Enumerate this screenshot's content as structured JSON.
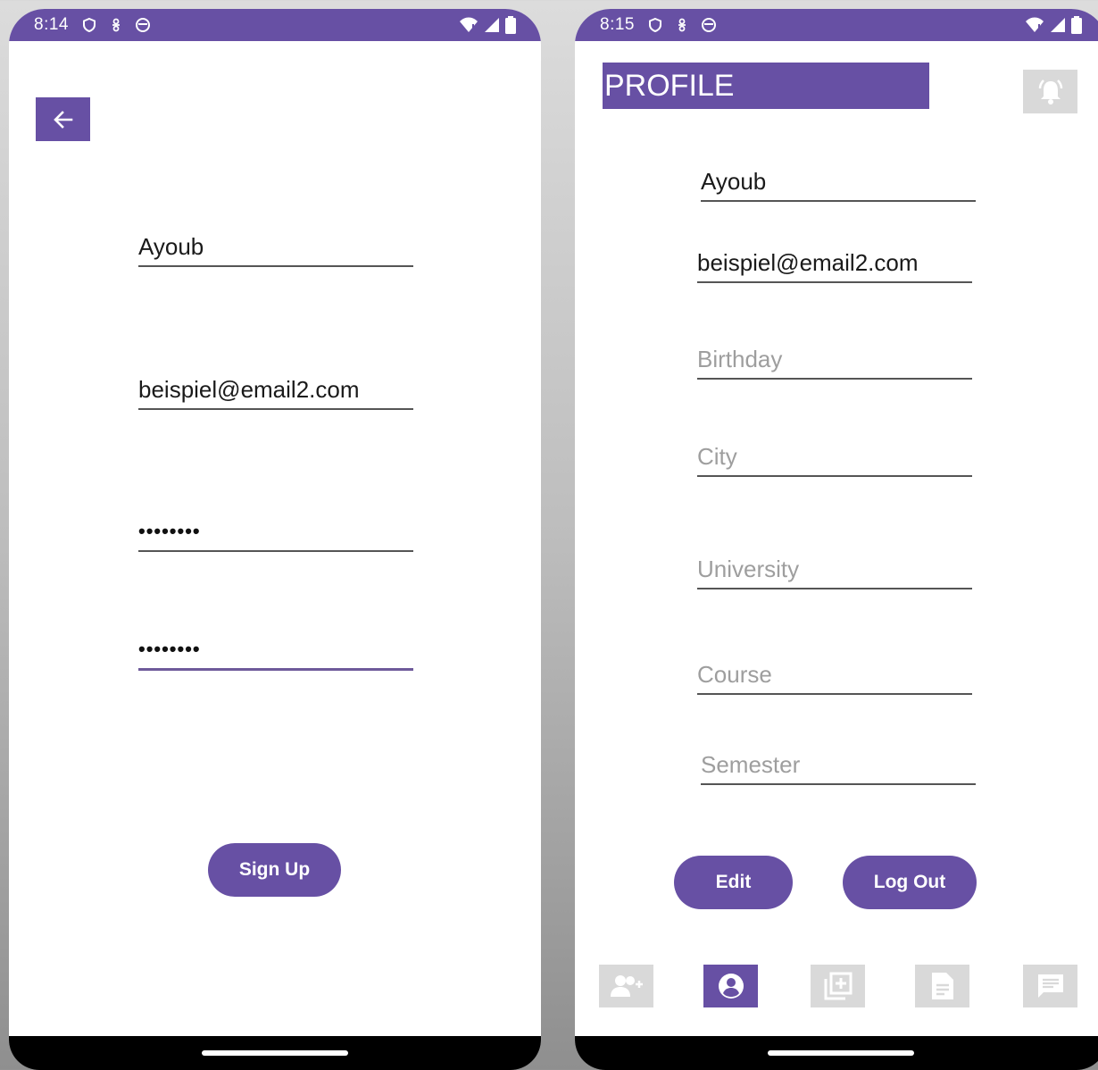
{
  "left_screen": {
    "status": {
      "time": "8:14"
    },
    "form": {
      "name": "Ayoub",
      "email": "beispiel@email2.com",
      "password": "••••••••",
      "confirm_password": "••••••••"
    },
    "sign_up_label": "Sign Up"
  },
  "right_screen": {
    "status": {
      "time": "8:15"
    },
    "title": "PROFILE",
    "fields": {
      "name": "Ayoub",
      "email": "beispiel@email2.com",
      "birthday_placeholder": "Birthday",
      "city_placeholder": "City",
      "university_placeholder": "University",
      "course_placeholder": "Course",
      "semester_placeholder": "Semester"
    },
    "edit_label": "Edit",
    "logout_label": "Log Out",
    "bottom_nav": [
      {
        "icon": "add-friend-icon",
        "active": false
      },
      {
        "icon": "profile-icon",
        "active": true
      },
      {
        "icon": "add-library-icon",
        "active": false
      },
      {
        "icon": "document-icon",
        "active": false
      },
      {
        "icon": "chat-icon",
        "active": false
      }
    ]
  },
  "colors": {
    "accent": "#6750a4",
    "inactive_nav": "#d9d9d9",
    "placeholder": "#9e9e9e"
  }
}
